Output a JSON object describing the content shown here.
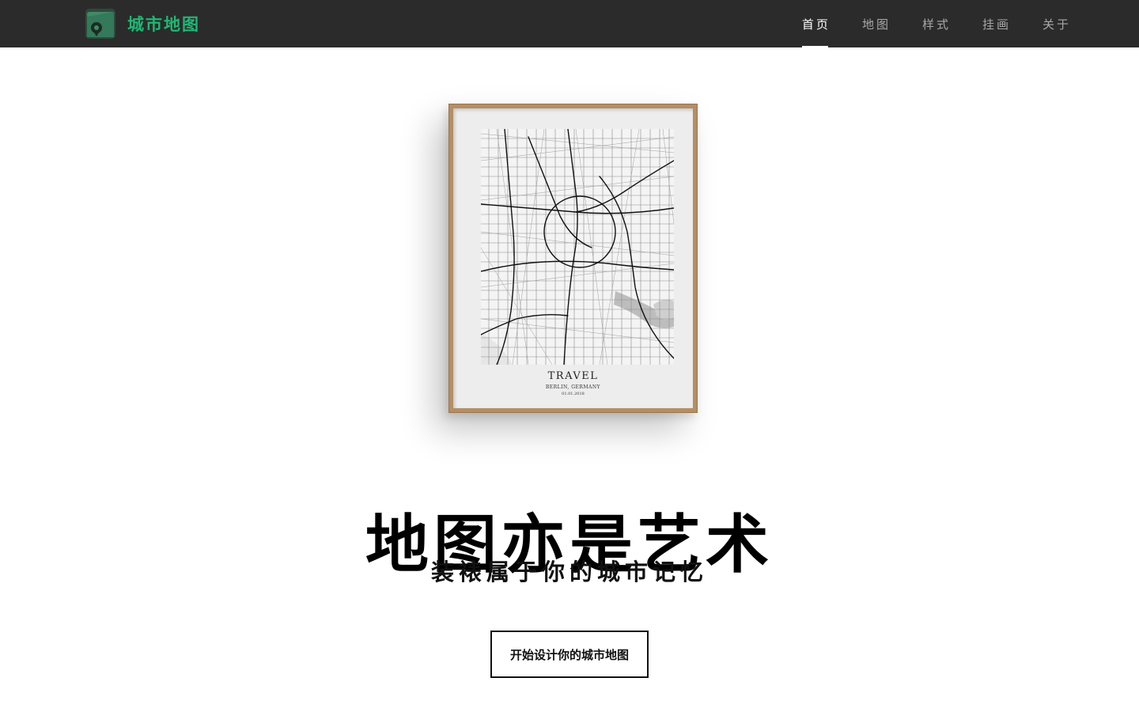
{
  "brand": {
    "name": "城市地图",
    "logo_icon": "map-pin-logo-icon",
    "color": "#1fb874"
  },
  "nav": {
    "items": [
      {
        "label": "首页",
        "active": true
      },
      {
        "label": "地图",
        "active": false
      },
      {
        "label": "样式",
        "active": false
      },
      {
        "label": "挂画",
        "active": false
      },
      {
        "label": "关于",
        "active": false
      }
    ]
  },
  "poster": {
    "title": "TRAVEL",
    "subtitle": "BERLIN, GERMANY",
    "date": "01.01.2018",
    "frame_color": "#b58e63"
  },
  "hero": {
    "title": "地图亦是艺术",
    "subtitle": "装裱属于你的城市记忆",
    "cta_label": "开始设计你的城市地图"
  }
}
